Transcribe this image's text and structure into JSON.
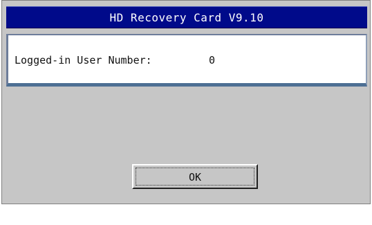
{
  "window": {
    "title": "HD Recovery Card V9.10",
    "title_bar_color": "#000a8a",
    "background_color": "#c6c6c6"
  },
  "info": {
    "label": "Logged-in User Number:",
    "value": "0"
  },
  "buttons": {
    "ok_label": "OK"
  }
}
